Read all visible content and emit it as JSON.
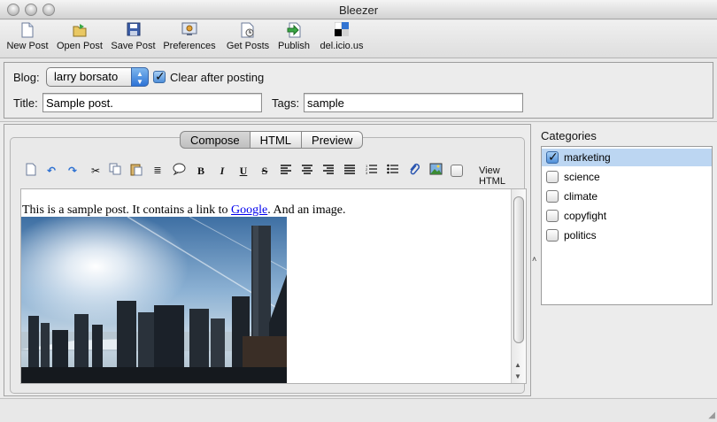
{
  "window": {
    "title": "Bleezer"
  },
  "toolbar": {
    "items": [
      {
        "label": "New Post",
        "icon": "new-post-icon"
      },
      {
        "label": "Open Post",
        "icon": "open-post-icon"
      },
      {
        "label": "Save Post",
        "icon": "save-post-icon"
      },
      {
        "label": "Preferences",
        "icon": "preferences-icon"
      },
      {
        "label": "Get Posts",
        "icon": "get-posts-icon"
      },
      {
        "label": "Publish",
        "icon": "publish-icon"
      },
      {
        "label": "del.icio.us",
        "icon": "delicious-icon"
      }
    ]
  },
  "form": {
    "blog_label": "Blog:",
    "blog_value": "larry borsato",
    "clear_label": "Clear after posting",
    "clear_checked": true,
    "title_label": "Title:",
    "title_value": "Sample post.",
    "tags_label": "Tags:",
    "tags_value": "sample"
  },
  "editor": {
    "tabs": [
      "Compose",
      "HTML",
      "Preview"
    ],
    "active_tab": "Compose",
    "view_html_label": "View HTML",
    "content_before_link": "This is a sample post. It contains a link to ",
    "content_link": "Google",
    "content_after_link": ". And an image."
  },
  "categories": {
    "title": "Categories",
    "items": [
      {
        "label": "marketing",
        "checked": true
      },
      {
        "label": "science",
        "checked": false
      },
      {
        "label": "climate",
        "checked": false
      },
      {
        "label": "copyfight",
        "checked": false
      },
      {
        "label": "politics",
        "checked": false
      }
    ]
  },
  "colors": {
    "selection": "#bcd6f2",
    "link": "#0000ee",
    "accent": "#2e73d6"
  }
}
